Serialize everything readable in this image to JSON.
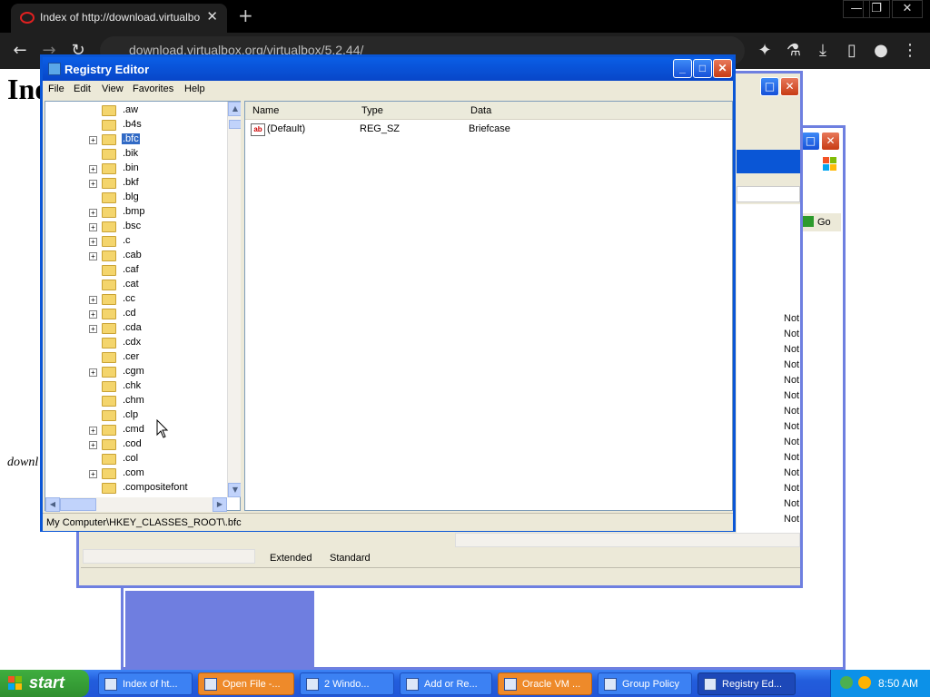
{
  "browser": {
    "tab_title": "Index of http://download.virtualbox",
    "tab_close": "✕",
    "new_tab": "+",
    "url": "download.virtualbox.org/virtualbox/5.2.44/",
    "minimize": "—",
    "restore": "❐",
    "close": "✕",
    "back": "←",
    "forward": "→",
    "reload": "↻"
  },
  "page": {
    "heading": "Ind",
    "italic_text": "downl"
  },
  "back_window": {
    "go_label": "Go",
    "rows": [
      "Not",
      "Not",
      "Not",
      "Not",
      "Not",
      "Not",
      "Not",
      "Not",
      "Not",
      "Not",
      "Not",
      "Not",
      "Not",
      "Not"
    ],
    "tab_extended": "Extended",
    "tab_standard": "Standard"
  },
  "registry": {
    "title": "Registry Editor",
    "menu": [
      "File",
      "Edit",
      "View",
      "Favorites",
      "Help"
    ],
    "tree": [
      {
        "label": ".aw",
        "expand": false
      },
      {
        "label": ".b4s",
        "expand": false
      },
      {
        "label": ".bfc",
        "expand": true,
        "selected": true
      },
      {
        "label": ".bik",
        "expand": false
      },
      {
        "label": ".bin",
        "expand": true
      },
      {
        "label": ".bkf",
        "expand": true
      },
      {
        "label": ".blg",
        "expand": false
      },
      {
        "label": ".bmp",
        "expand": true
      },
      {
        "label": ".bsc",
        "expand": true
      },
      {
        "label": ".c",
        "expand": true
      },
      {
        "label": ".cab",
        "expand": true
      },
      {
        "label": ".caf",
        "expand": false
      },
      {
        "label": ".cat",
        "expand": false
      },
      {
        "label": ".cc",
        "expand": true
      },
      {
        "label": ".cd",
        "expand": true
      },
      {
        "label": ".cda",
        "expand": true
      },
      {
        "label": ".cdx",
        "expand": false
      },
      {
        "label": ".cer",
        "expand": false
      },
      {
        "label": ".cgm",
        "expand": true
      },
      {
        "label": ".chk",
        "expand": false
      },
      {
        "label": ".chm",
        "expand": false
      },
      {
        "label": ".clp",
        "expand": false
      },
      {
        "label": ".cmd",
        "expand": true
      },
      {
        "label": ".cod",
        "expand": true
      },
      {
        "label": ".col",
        "expand": false
      },
      {
        "label": ".com",
        "expand": true
      },
      {
        "label": ".compositefont",
        "expand": false
      }
    ],
    "columns": [
      "Name",
      "Type",
      "Data"
    ],
    "values": [
      {
        "name": "(Default)",
        "type": "REG_SZ",
        "data": "Briefcase"
      }
    ],
    "status": "My Computer\\HKEY_CLASSES_ROOT\\.bfc"
  },
  "taskbar": {
    "start": "start",
    "buttons": [
      {
        "label": "Index of ht...",
        "style": "blue"
      },
      {
        "label": "Open File -...",
        "style": "orange"
      },
      {
        "label": "2 Windo...",
        "style": "blue"
      },
      {
        "label": "Add or Re...",
        "style": "blue"
      },
      {
        "label": "Oracle VM ...",
        "style": "orange"
      },
      {
        "label": "Group Policy",
        "style": "blue"
      },
      {
        "label": "Registry Ed...",
        "style": "active"
      }
    ],
    "clock": "8:50 AM"
  },
  "colors": {
    "xp_title": "#0a56d6",
    "selection": "#316ac5",
    "taskbar": "#2156d8"
  }
}
